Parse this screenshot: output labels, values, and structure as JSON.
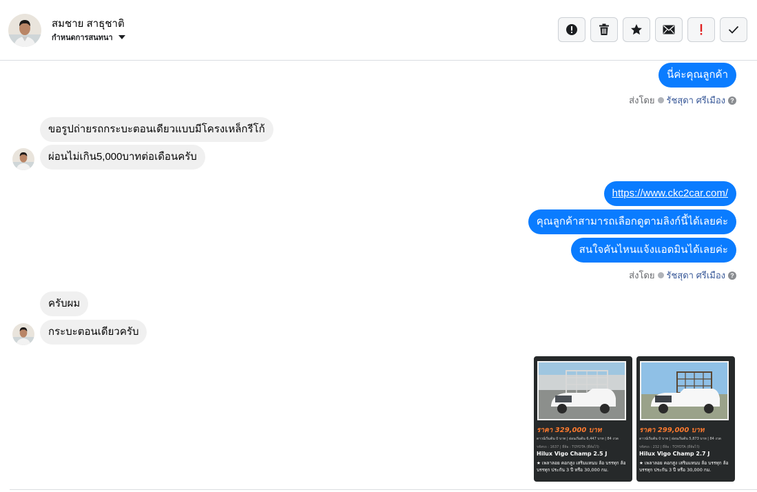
{
  "header": {
    "contact_name": "สมชาย สาธุชาติ",
    "assign_label": "กำหนดการสนทนา",
    "toolbar": [
      {
        "name": "report-button",
        "icon": "alert-circle-icon"
      },
      {
        "name": "delete-button",
        "icon": "trash-icon"
      },
      {
        "name": "star-button",
        "icon": "star-icon"
      },
      {
        "name": "mark-unread-button",
        "icon": "envelope-icon"
      },
      {
        "name": "important-button",
        "icon": "exclamation-icon"
      },
      {
        "name": "done-button",
        "icon": "check-icon"
      }
    ]
  },
  "messages": {
    "out1": "นี่ค่ะคุณลูกค้า",
    "in1": "ขอรูปถ่ายรถกระบะตอนเดียวแบบมีโครงเหล็กรีโก้",
    "in2": "ผ่อนไม่เกิน5,000บาทต่อเดือนครับ",
    "out_link": "https://www.ckc2car.com/",
    "out2": "คุณลูกค้าสามารถเลือกดูตามลิงก์นี้ได้เลยค่ะ",
    "out3": "สนใจคันไหนแจ้งแอดมินได้เลยค่ะ",
    "in3": "ครับผม",
    "in4": "กระบะตอนเดียวครับ"
  },
  "sent_by": {
    "prefix": "ส่งโดย",
    "agent": "รัชสุดา ศรีเมือง",
    "help": "?"
  },
  "cards": [
    {
      "price": "ราคา 329,000 บาท",
      "terms": "ดาวน์เริ่มต้น 0 บาท | ผ่อนเริ่มต้น 6,447 บาท | 84 งวด",
      "meta": "รหัสรถ : 1637 | ยี่ห้อ : TOYOTA (ยี่ห้อไว้)",
      "model": "Hilux Vigo Champ 2.5 J",
      "desc": "★ เพลาลอย คอกสูง เสริมแหนบ ล้อ บรรทุก ล้อบรรทุก ประกัน 3 ปี หรือ 30,000 กม."
    },
    {
      "price": "ราคา 299,000 บาท",
      "terms": "ดาวน์เริ่มต้น 0 บาท | ผ่อนเริ่มต้น 5,873 บาท | 84 งวด",
      "meta": "รหัสรถ : 232 | ยี่ห้อ : TOYOTA (ยี่ห้อไว้)",
      "model": "Hilux Vigo Champ 2.7 J",
      "desc": "★ เพลาลอย คอกสูง เสริมแหนบ ล้อ บรรทุก ล้อบรรทุก ประกัน 3 ปี หรือ 30,000 กม."
    }
  ],
  "colors": {
    "outgoing": "#0a7cff",
    "incoming": "#f0f0f0",
    "price": "#ff7a2e",
    "important": "#e02020"
  }
}
